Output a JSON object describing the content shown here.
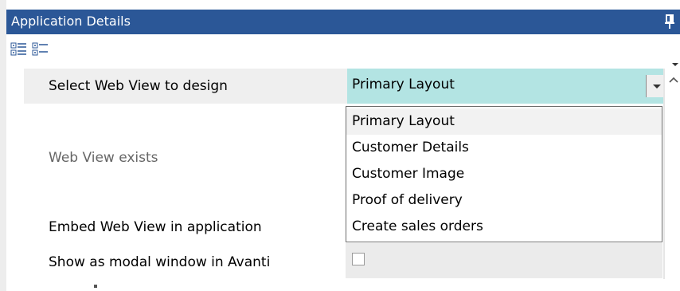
{
  "panel": {
    "title": "Application Details"
  },
  "properties": {
    "select_web_view_label": "Select Web View to design",
    "selected_value": "Primary Layout",
    "web_view_exists_label": "Web View exists",
    "embed_label": "Embed Web View in application",
    "modal_label": "Show as modal window in Avanti",
    "modal_checked": false
  },
  "dropdown": {
    "options": [
      "Primary Layout",
      "Customer Details",
      "Customer Image",
      "Proof of delivery",
      "Create sales orders"
    ],
    "selected_index": 0
  },
  "icons": {
    "pin": "pin-icon",
    "categorized": "categorized-view-icon",
    "alphabetical": "alphabetical-view-icon",
    "dropdown": "chevron-down-icon",
    "scroll_up": "scroll-up-icon"
  },
  "colors": {
    "title_bar": "#2b5797",
    "title_text": "#ffffff",
    "selected_field": "#b3e4e3",
    "row_bg": "#efefef",
    "muted_text": "#666666"
  }
}
